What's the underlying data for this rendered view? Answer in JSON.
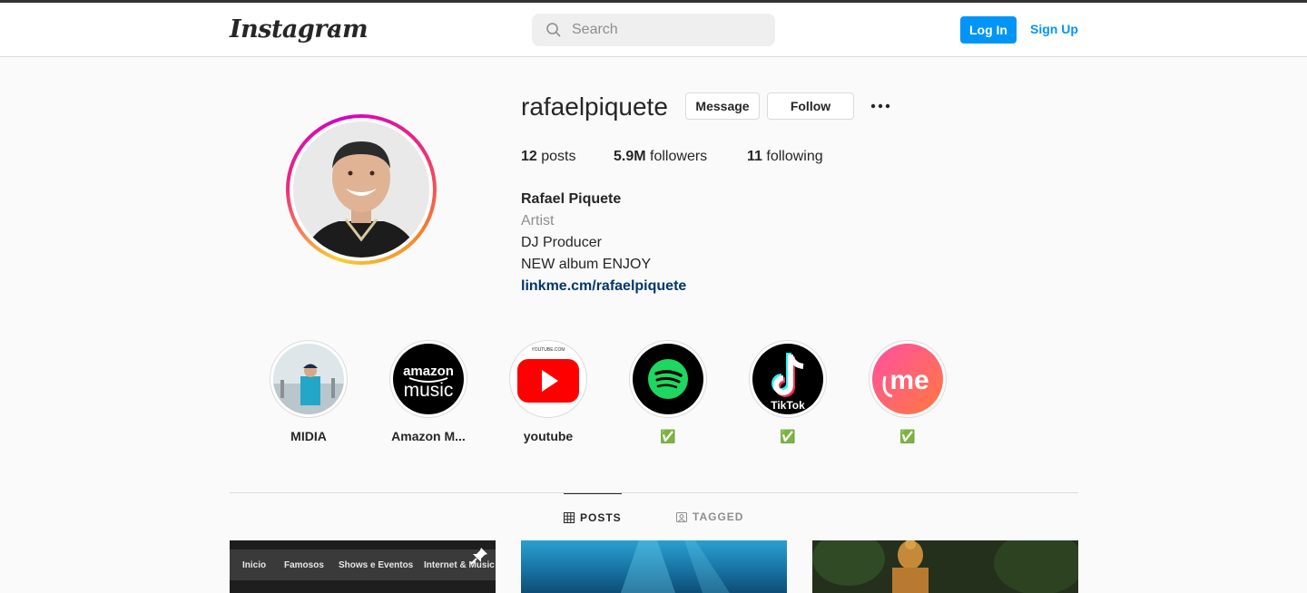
{
  "header": {
    "logo": "Instagram",
    "search_placeholder": "Search",
    "login_label": "Log In",
    "signup_label": "Sign Up"
  },
  "profile": {
    "username": "rafaelpiquete",
    "message_label": "Message",
    "follow_label": "Follow",
    "stats": [
      {
        "count": "12",
        "label": "posts"
      },
      {
        "count": "5.9M",
        "label": "followers"
      },
      {
        "count": "11",
        "label": "following"
      }
    ],
    "full_name": "Rafael Piquete",
    "category": "Artist",
    "bio_lines": [
      "DJ Producer",
      "NEW album ENJOY"
    ],
    "link": "linkme.cm/rafaelpiquete"
  },
  "highlights": [
    {
      "label": "MIDIA",
      "icon": "midia-photo"
    },
    {
      "label": "Amazon M...",
      "icon": "amazon-music-logo",
      "logo_text": [
        "amazon",
        "music"
      ]
    },
    {
      "label": "youtube",
      "icon": "youtube-logo",
      "logo_text": "YOUTUBE.COM"
    },
    {
      "label": "✅",
      "icon": "spotify-logo"
    },
    {
      "label": "✅",
      "icon": "tiktok-logo",
      "logo_text": "TikTok"
    },
    {
      "label": "✅",
      "icon": "linkme-logo",
      "logo_text": "me"
    }
  ],
  "tabs": [
    {
      "label": "POSTS",
      "active": true
    },
    {
      "label": "TAGGED",
      "active": false
    }
  ],
  "posts": [
    {
      "nav_items": [
        "Inicio",
        "Famosos",
        "Shows e Eventos",
        "Internet & Music"
      ],
      "pinned": true
    },
    {},
    {}
  ],
  "colors": {
    "accent": "#0095f6",
    "link": "#00376b",
    "border": "#dbdbdb",
    "background": "#fafafa"
  }
}
